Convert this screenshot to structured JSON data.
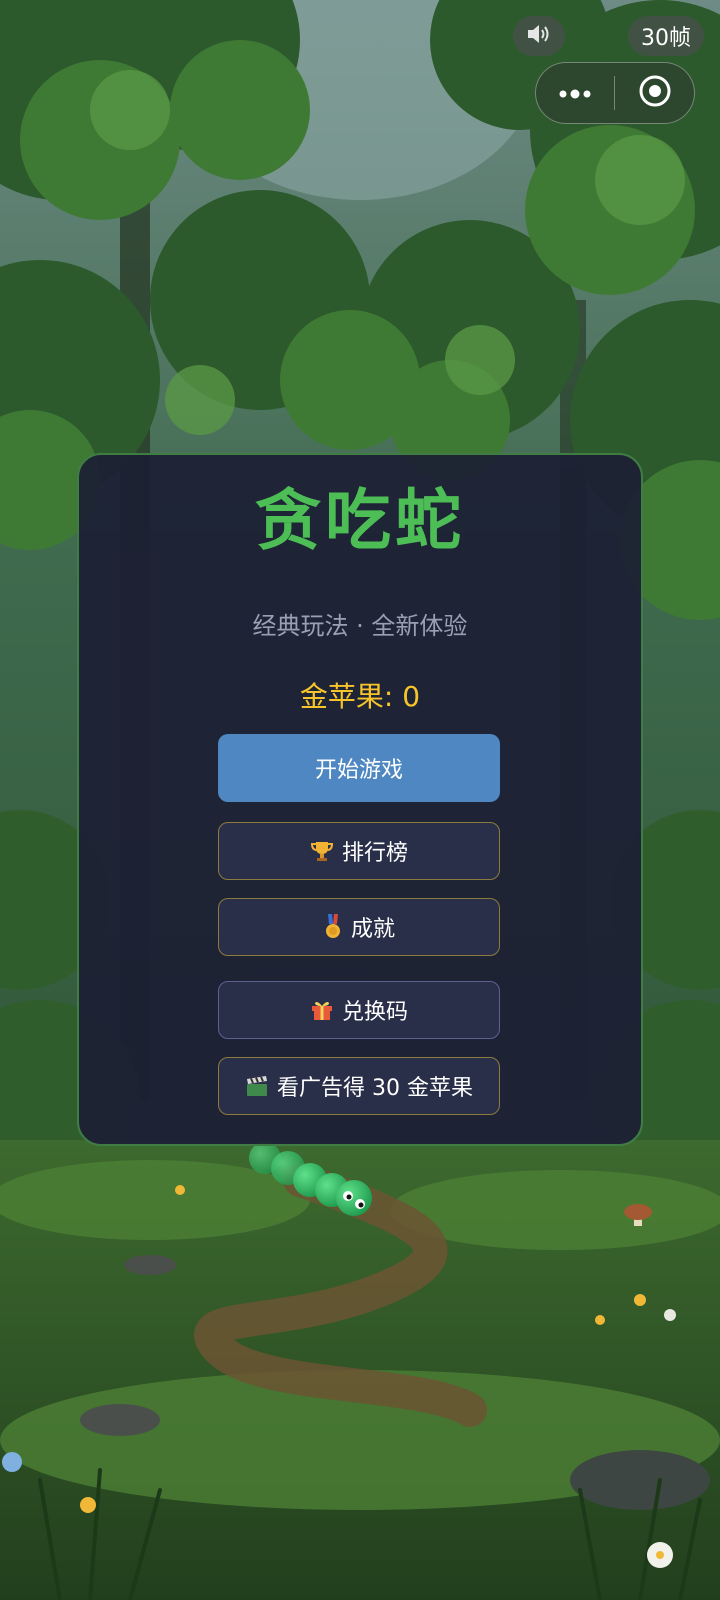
{
  "status": {
    "sound_icon": "speaker-icon",
    "fps_label": "30帧"
  },
  "capsule": {
    "more_icon": "more-dots-icon",
    "close_icon": "target-icon"
  },
  "menu": {
    "title": "贪吃蛇",
    "subtitle": "经典玩法 · 全新体验",
    "apples_label": "金苹果: 0",
    "start_label": "开始游戏",
    "leaderboard_label": "排行榜",
    "achievements_label": "成就",
    "redeem_label": "兑换码",
    "ad_label": "看广告得 30 金苹果"
  },
  "colors": {
    "title": "#4cbe55",
    "apples": "#f7c42b",
    "start_button": "#4e87c2",
    "panel": "#1c1f34",
    "panel_border": "#3f7d45"
  }
}
